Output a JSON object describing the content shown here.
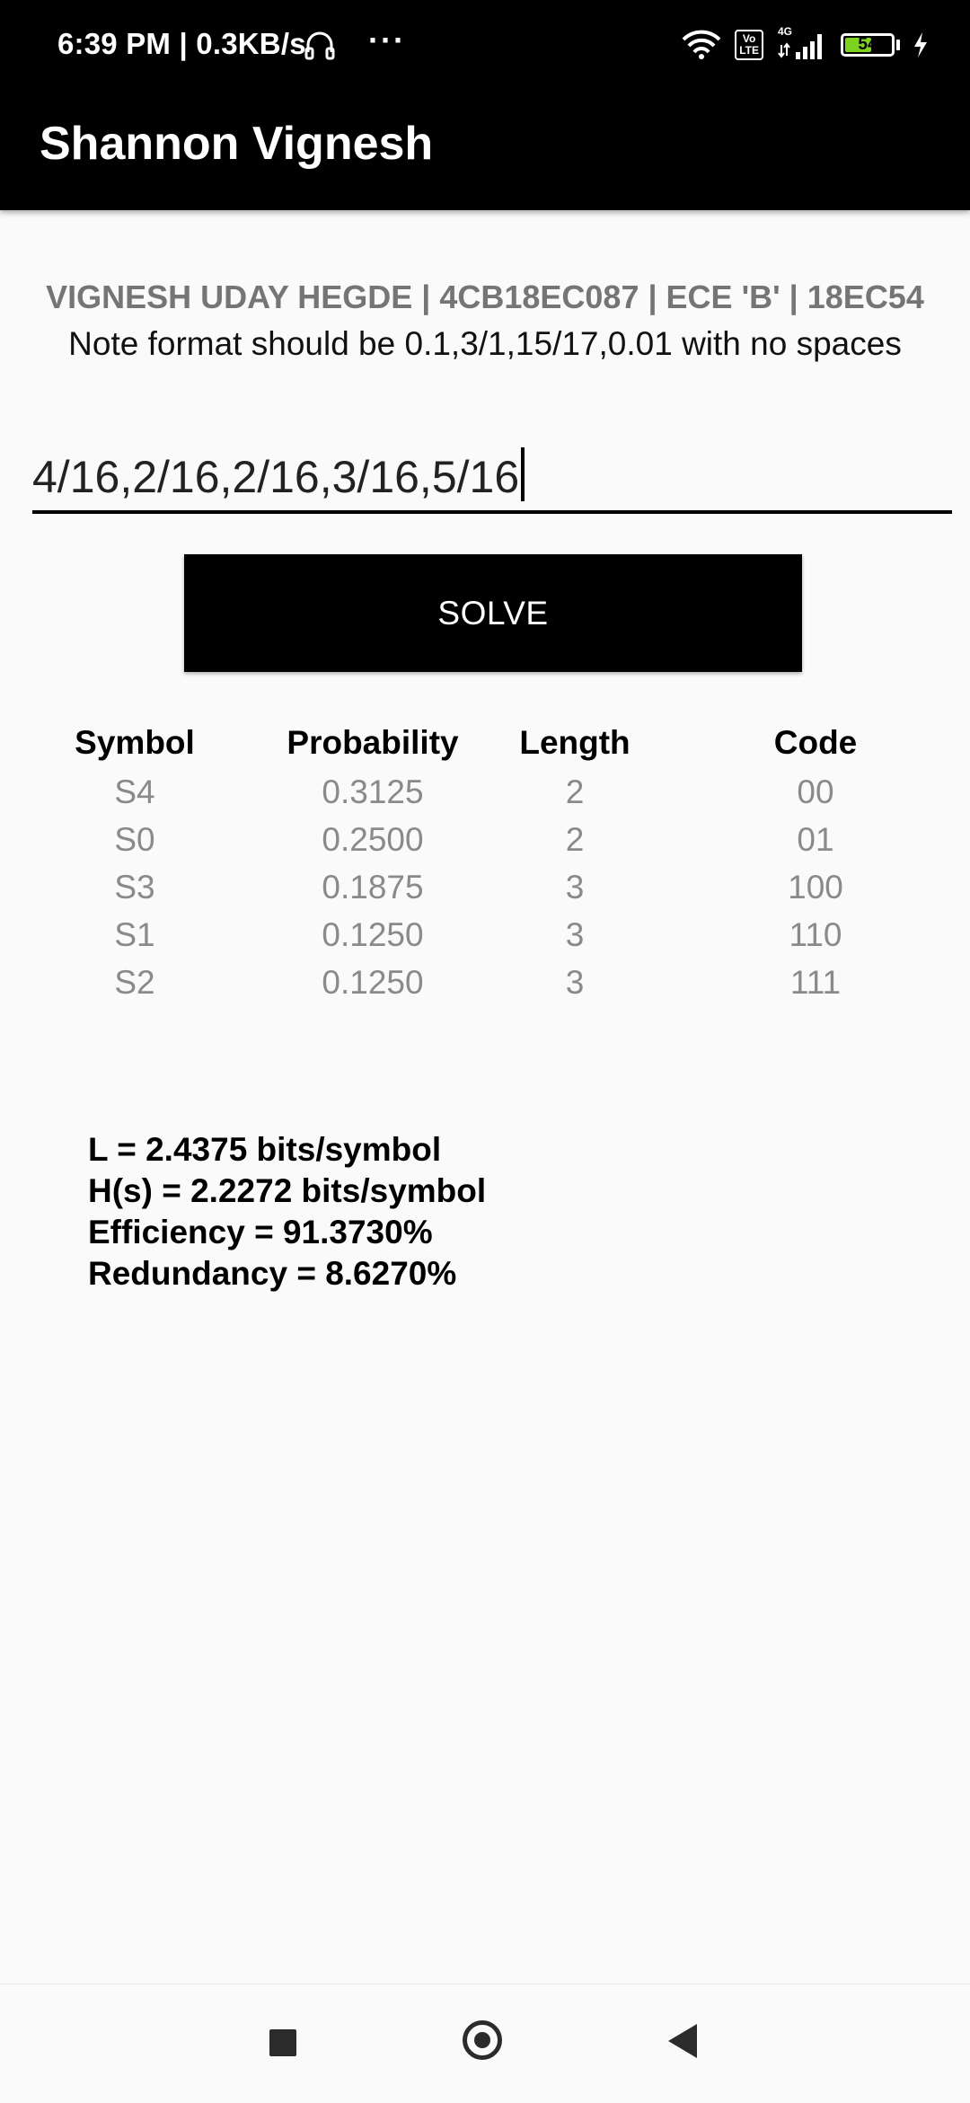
{
  "status_bar": {
    "time": "6:39 PM | 0.3KB/s",
    "more": "···",
    "lte_top": "Vo",
    "lte_bottom": "LTE",
    "network": "4G",
    "battery_level": "54"
  },
  "app_bar": {
    "title": "Shannon Vignesh"
  },
  "header": {
    "subtitle": "VIGNESH UDAY HEGDE | 4CB18EC087 | ECE 'B' | 18EC54",
    "note": "Note format should be 0.1,3/1,15/17,0.01 with no spaces"
  },
  "input": {
    "value": "4/16,2/16,2/16,3/16,5/16"
  },
  "solve_button": {
    "label": "SOLVE"
  },
  "table": {
    "headers": [
      "Symbol",
      "Probability",
      "Length",
      "Code"
    ],
    "rows": [
      [
        "S4",
        "0.3125",
        "2",
        "00"
      ],
      [
        "S0",
        "0.2500",
        "2",
        "01"
      ],
      [
        "S3",
        "0.1875",
        "3",
        "100"
      ],
      [
        "S1",
        "0.1250",
        "3",
        "110"
      ],
      [
        "S2",
        "0.1250",
        "3",
        "111"
      ]
    ]
  },
  "results": {
    "length": "L = 2.4375 bits/symbol",
    "entropy": "H(s) = 2.2272 bits/symbol",
    "efficiency": "Efficiency = 91.3730%",
    "redundancy": "Redundancy = 8.6270%"
  },
  "nav_bar": {
    "icons": [
      "recents-square-icon",
      "home-circle-icon",
      "back-triangle-icon"
    ]
  }
}
